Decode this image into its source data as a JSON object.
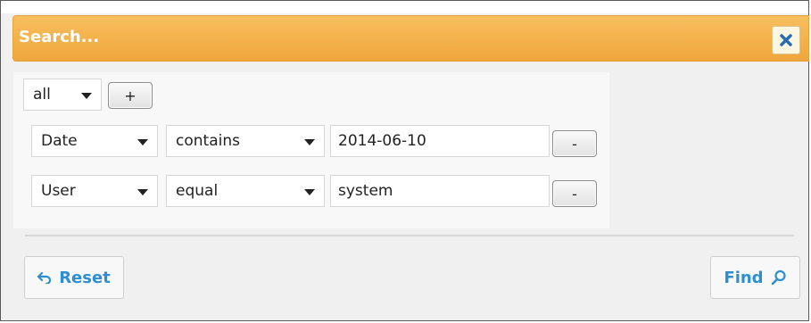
{
  "dialog": {
    "title": "Search...",
    "close_icon": "close-x-icon",
    "accent_color": "#f0a63c"
  },
  "group": {
    "match_value": "all",
    "add_label": "+"
  },
  "rules": [
    {
      "field": "Date",
      "operator": "contains",
      "value": "2014-06-10",
      "remove_label": "-"
    },
    {
      "field": "User",
      "operator": "equal",
      "value": "system",
      "remove_label": "-"
    }
  ],
  "footer": {
    "reset_label": "Reset",
    "reset_icon": "undo-arrow-icon",
    "find_label": "Find",
    "find_icon": "search-icon",
    "link_color": "#2e8fd0"
  }
}
